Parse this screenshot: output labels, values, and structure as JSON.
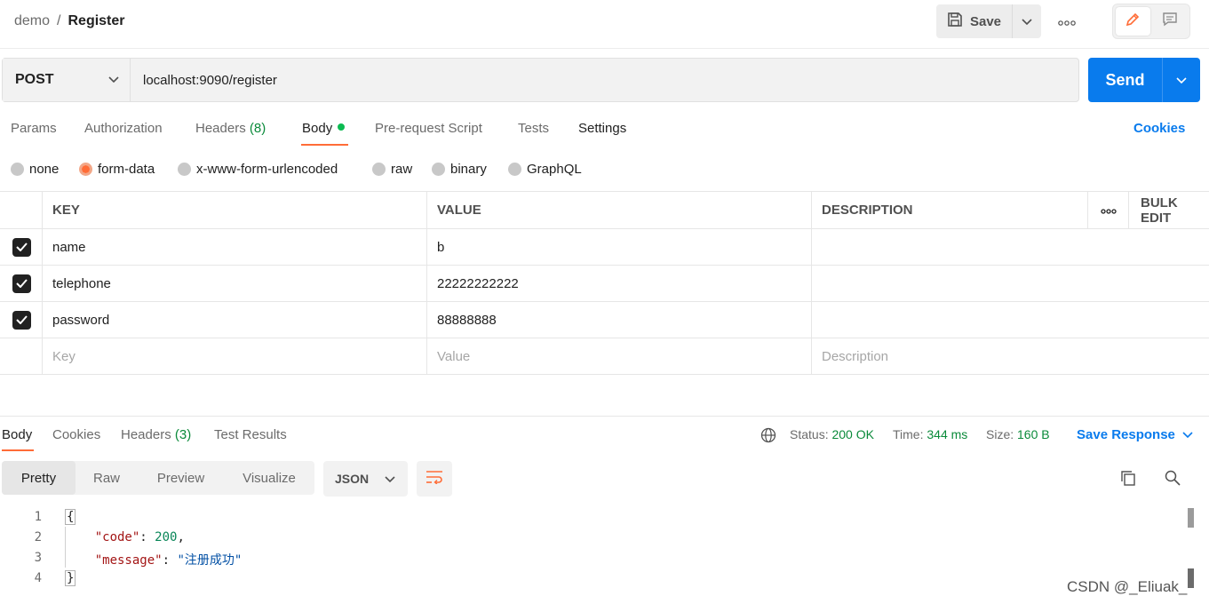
{
  "breadcrumb": {
    "parent": "demo",
    "separator": "/",
    "current": "Register"
  },
  "toolbar": {
    "save_label": "Save"
  },
  "request": {
    "method": "POST",
    "url": "localhost:9090/register",
    "send_label": "Send"
  },
  "req_tabs": {
    "params": "Params",
    "authorization": "Authorization",
    "headers": "Headers",
    "headers_count": "(8)",
    "body": "Body",
    "prerequest": "Pre-request Script",
    "tests": "Tests",
    "settings": "Settings",
    "cookies": "Cookies"
  },
  "body_types": {
    "none": "none",
    "form_data": "form-data",
    "urlencoded": "x-www-form-urlencoded",
    "raw": "raw",
    "binary": "binary",
    "graphql": "GraphQL",
    "selected": "form-data"
  },
  "params_table": {
    "headers": {
      "key": "KEY",
      "value": "VALUE",
      "description": "DESCRIPTION",
      "bulk_edit": "Bulk Edit"
    },
    "rows": [
      {
        "key": "name",
        "value": "b",
        "description": "",
        "checked": true
      },
      {
        "key": "telephone",
        "value": "22222222222",
        "description": "",
        "checked": true
      },
      {
        "key": "password",
        "value": "88888888",
        "description": "",
        "checked": true
      }
    ],
    "placeholder": {
      "key": "Key",
      "value": "Value",
      "description": "Description"
    }
  },
  "response": {
    "tabs": {
      "body": "Body",
      "cookies": "Cookies",
      "headers": "Headers",
      "headers_count": "(3)",
      "test_results": "Test Results"
    },
    "status_label": "Status:",
    "status_value": "200 OK",
    "time_label": "Time:",
    "time_value": "344 ms",
    "size_label": "Size:",
    "size_value": "160 B",
    "save_response": "Save Response",
    "views": {
      "pretty": "Pretty",
      "raw": "Raw",
      "preview": "Preview",
      "visualize": "Visualize"
    },
    "format": "JSON",
    "lines": {
      "n1": "1",
      "n2": "2",
      "n3": "3",
      "n4": "4",
      "open_brace": "{",
      "code_key": "\"code\"",
      "code_val": "200",
      "message_key": "\"message\"",
      "message_val": "\"注册成功\"",
      "close_brace": "}"
    }
  },
  "watermark": "CSDN @_Eliuak_",
  "colors": {
    "accent": "#ff6c37",
    "send": "#097bed",
    "ok": "#0a8a3a",
    "link": "#097bed"
  }
}
